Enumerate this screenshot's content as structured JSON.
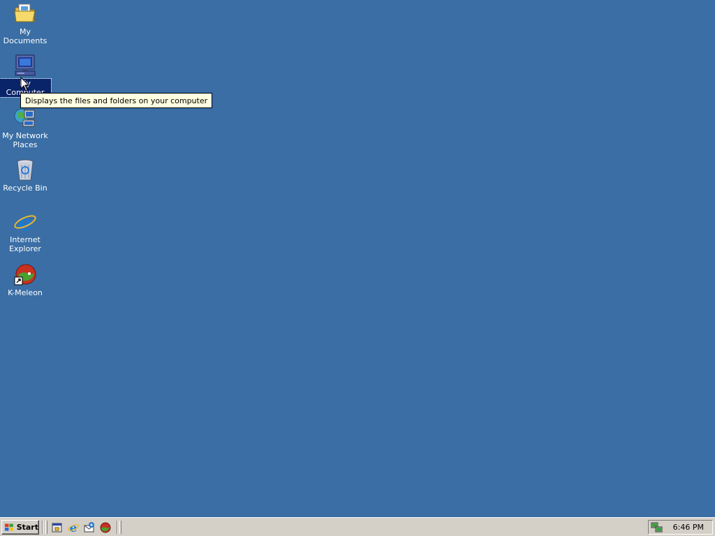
{
  "desktop": {
    "background": "#3a6ea5",
    "icons": [
      {
        "label": "My Documents",
        "icon": "my-documents-icon"
      },
      {
        "label": "My Computer",
        "icon": "my-computer-icon",
        "selected": true
      },
      {
        "label": "My Network Places",
        "icon": "network-places-icon"
      },
      {
        "label": "Recycle Bin",
        "icon": "recycle-bin-icon"
      },
      {
        "label": "Internet Explorer",
        "icon": "internet-explorer-icon"
      },
      {
        "label": "K-Meleon",
        "icon": "k-meleon-icon",
        "shortcut": true
      }
    ],
    "tooltip": "Displays the files and folders on your computer"
  },
  "taskbar": {
    "start_label": "Start",
    "quick_launch": [
      "show-desktop-icon",
      "internet-explorer-icon",
      "outlook-express-icon",
      "k-meleon-icon"
    ],
    "tray": {
      "icons": [
        "network-tray-icon"
      ],
      "clock": "6:46 PM"
    }
  }
}
